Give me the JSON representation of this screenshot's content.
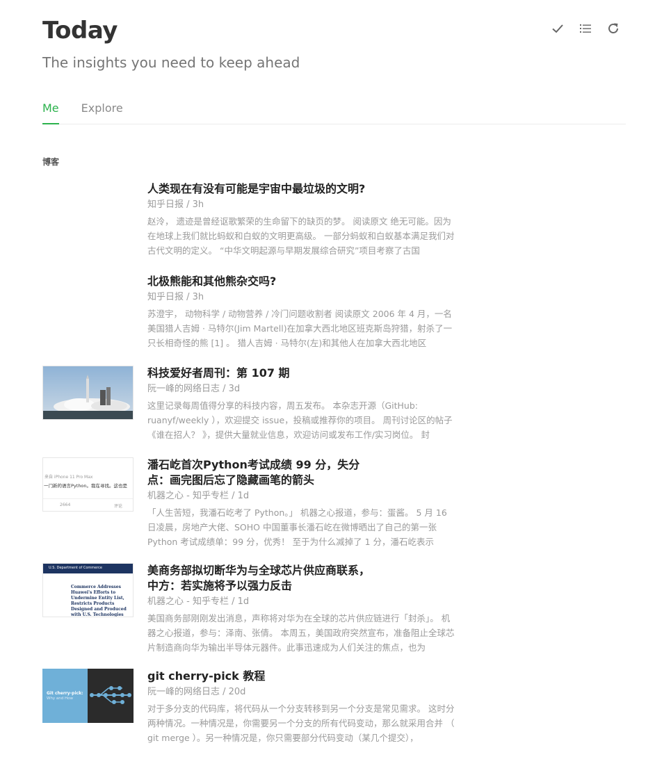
{
  "header": {
    "title": "Today",
    "subtitle": "The insights you need to keep ahead"
  },
  "toolbar": {
    "icons": [
      "checkmark-icon",
      "list-view-icon",
      "refresh-icon"
    ]
  },
  "tabs": [
    {
      "label": "Me",
      "active": true
    },
    {
      "label": "Explore",
      "active": false
    }
  ],
  "section": {
    "label": "博客"
  },
  "entries": [
    {
      "title": "人类现在有没有可能是宇宙中最垃圾的文明?",
      "meta": "知乎日报 / 3h",
      "summary": "赵泠， 遗迹是曾经讴歌繁荣的生命留下的缺页的梦。 阅读原文 绝无可能。因为在地球上我们就比蚂蚁和白蚁的文明更高级。 一部分蚂蚁和白蚁基本满足我们对古代文明的定义。 “中华文明起源与早期发展综合研究”项目考察了古国"
    },
    {
      "title": "北极熊能和其他熊杂交吗?",
      "meta": "知乎日报 / 3h",
      "summary": "苏澄宇， 动物科学 / 动物营养 / 冷门问题收割者 阅读原文 2006 年 4 月，一名美国猎人吉姆 · 马特尔(Jim Martell)在加拿大西北地区班克斯岛狩猎，射杀了一只长相奇怪的熊 [1] 。 猎人吉姆 · 马特尔(左)和其他人在加拿大西北地区"
    },
    {
      "title": "科技爱好者周刊：第 107 期",
      "meta": "阮一峰的网络日志 / 3d",
      "summary": "这里记录每周值得分享的科技内容，周五发布。 本杂志开源（GitHub: ruanyf/weekly ），欢迎提交 issue，投稿或推荐你的项目。 周刊讨论区的帖子 《谁在招人？ 》，提供大量就业信息，欢迎访问或发布工作/实习岗位。 封"
    },
    {
      "title": "潘石屹首次Python考试成绩 99 分，失分点：画完图后忘了隐藏画笔的箭头",
      "meta": "机器之心 - 知乎专栏 / 1d",
      "summary": "「人生苦短，我潘石屹考了 Python。」 机器之心报道，参与：蛋酱。 5 月 16 日凌晨，房地产大佬、SOHO 中国董事长潘石屹在微博晒出了自己的第一张 Python 考试成绩单：99 分，优秀！ 至于为什么减掉了 1 分，潘石屹表示",
      "thumb_text": {
        "device": "来自 iPhone 11 Pro Max",
        "line": "一门新的语言Python。我在寻找。这也是",
        "count": "2664",
        "comment": "评论"
      }
    },
    {
      "title": "美商务部拟切断华为与全球芯片供应商联系，中方：若实施将予以强力反击",
      "meta": "机器之心 - 知乎专栏 / 1d",
      "summary": "美国商务部刚刚发出消息，声称将对华为在全球的芯片供应链进行「封杀」。 机器之心报道，参与：泽南、张倩。 本周五，美国政府突然宣布，准备阻止全球芯片制造商向华为输出半导体元器件。此事迅速成为人们关注的焦点，也为",
      "thumb_text": {
        "org": "U.S. Department of Commerce",
        "headline": "Commerce Addresses Huawei's Efforts to Undermine Entity List, Restricts Products Designed and Produced with U.S. Technologies"
      }
    },
    {
      "title": "git cherry-pick 教程",
      "meta": "阮一峰的网络日志 / 20d",
      "summary": "对于多分支的代码库，将代码从一个分支转移到另一个分支是常见需求。 这时分两种情况。一种情况是，你需要另一个分支的所有代码变动，那么就采用合并 （ git merge ）。另一种情况是，你只需要部分代码变动（某几个提交），",
      "thumb_text": {
        "line1": "Git cherry-pick:",
        "line2": "Why and How"
      }
    }
  ]
}
